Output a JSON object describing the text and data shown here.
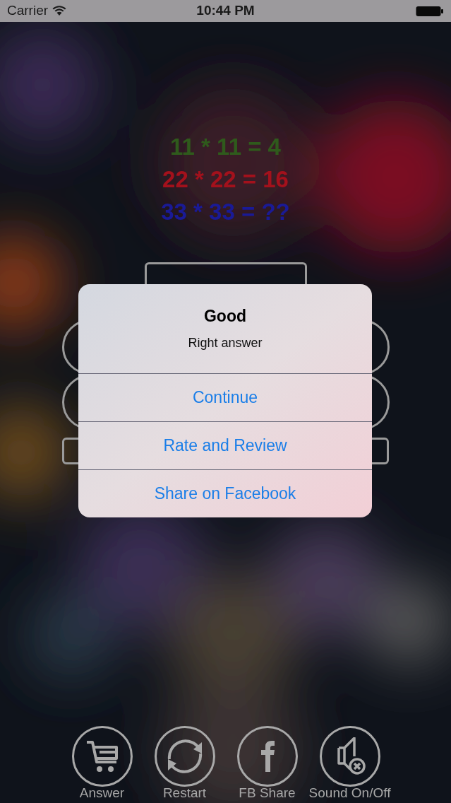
{
  "status_bar": {
    "carrier": "Carrier",
    "time": "10:44 PM"
  },
  "equations": [
    {
      "text": "11 * 11 = 4",
      "color": "#2f5a1c"
    },
    {
      "text": "22 * 22 = 16",
      "color": "#a3111c"
    },
    {
      "text": "33 * 33 = ??",
      "color": "#1a1a96"
    }
  ],
  "alert": {
    "title": "Good",
    "message": "Right answer",
    "actions": [
      "Continue",
      "Rate and Review",
      "Share on Facebook"
    ]
  },
  "toolbar": [
    {
      "label": "Answer",
      "kind": "cart"
    },
    {
      "label": "Restart",
      "kind": "restart"
    },
    {
      "label": "FB Share",
      "kind": "facebook"
    },
    {
      "label": "Sound On/Off",
      "kind": "sound-off"
    }
  ]
}
